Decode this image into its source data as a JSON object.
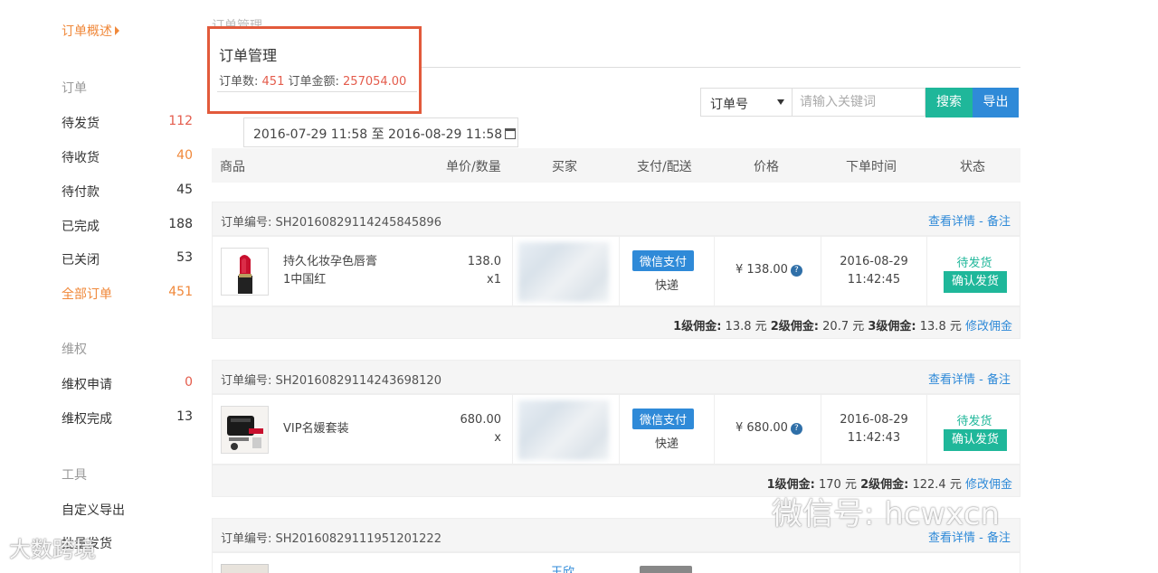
{
  "sidebar": {
    "overview": "订单概述",
    "sections": {
      "order": "订单",
      "rights": "维权",
      "tools": "工具"
    },
    "order_items": [
      {
        "label": "待发货",
        "count": "112"
      },
      {
        "label": "待收货",
        "count": "40"
      },
      {
        "label": "待付款",
        "count": "45"
      },
      {
        "label": "已完成",
        "count": "188"
      },
      {
        "label": "已关闭",
        "count": "53"
      },
      {
        "label": "全部订单",
        "count": "451"
      }
    ],
    "rights_items": [
      {
        "label": "维权申请",
        "count": "0"
      },
      {
        "label": "维权完成",
        "count": "13"
      }
    ],
    "tool_items": [
      {
        "label": "自定义导出"
      },
      {
        "label": "批量发货"
      }
    ]
  },
  "header": {
    "title": "订单管理",
    "stats_order_label": "订单数:",
    "stats_order_count": "451",
    "stats_amount_label": "订单金额:",
    "stats_amount_value": "257054.00"
  },
  "search": {
    "select_value": "订单号",
    "placeholder": "请输入关键词",
    "search_label": "搜索",
    "export_label": "导出"
  },
  "date_range": "2016-07-29 11:58 至 2016-08-29 11:58",
  "table_headers": [
    "商品",
    "单价/数量",
    "买家",
    "支付/配送",
    "价格",
    "下单时间",
    "状态"
  ],
  "orders": [
    {
      "order_no_label": "订单编号:",
      "order_no": "SH20160829114245845896",
      "detail_link": "查看详情",
      "note_link": "备注",
      "product_name_1": "持久化妆孕色唇膏",
      "product_name_2": "1中国红",
      "unit_price": "138.0",
      "quantity": "x1",
      "payment": "微信支付",
      "shipping": "快递",
      "price": "¥ 138.00",
      "date": "2016-08-29",
      "time": "11:42:45",
      "status": "待发货",
      "action": "确认发货",
      "commission": [
        {
          "label": "1级佣金:",
          "value": "13.8 元"
        },
        {
          "label": "2级佣金:",
          "value": "20.7 元"
        },
        {
          "label": "3级佣金:",
          "value": "13.8 元"
        }
      ],
      "edit_commission": "修改佣金"
    },
    {
      "order_no_label": "订单编号:",
      "order_no": "SH20160829114243698120",
      "detail_link": "查看详情",
      "note_link": "备注",
      "product_name_1": "VIP名媛套装",
      "product_name_2": "",
      "unit_price": "680.00",
      "quantity": "x",
      "payment": "微信支付",
      "shipping": "快递",
      "price": "¥ 680.00",
      "date": "2016-08-29",
      "time": "11:42:43",
      "status": "待发货",
      "action": "确认发货",
      "commission": [
        {
          "label": "1级佣金:",
          "value": "170 元"
        },
        {
          "label": "2级佣金:",
          "value": "122.4 元"
        }
      ],
      "edit_commission": "修改佣金"
    },
    {
      "order_no_label": "订单编号:",
      "order_no": "SH20160829111951201222",
      "detail_link": "查看详情",
      "note_link": "备注",
      "buyer_partial": "王欣"
    }
  ],
  "watermarks": {
    "wechat": "微信号: hcwxcn",
    "logo": "大数跨境"
  },
  "colors": {
    "accent_orange": "#f0883a",
    "red": "#e45c4c",
    "teal": "#1fb79a",
    "blue": "#2f8ad8",
    "highlight_border": "#e25a3b"
  }
}
